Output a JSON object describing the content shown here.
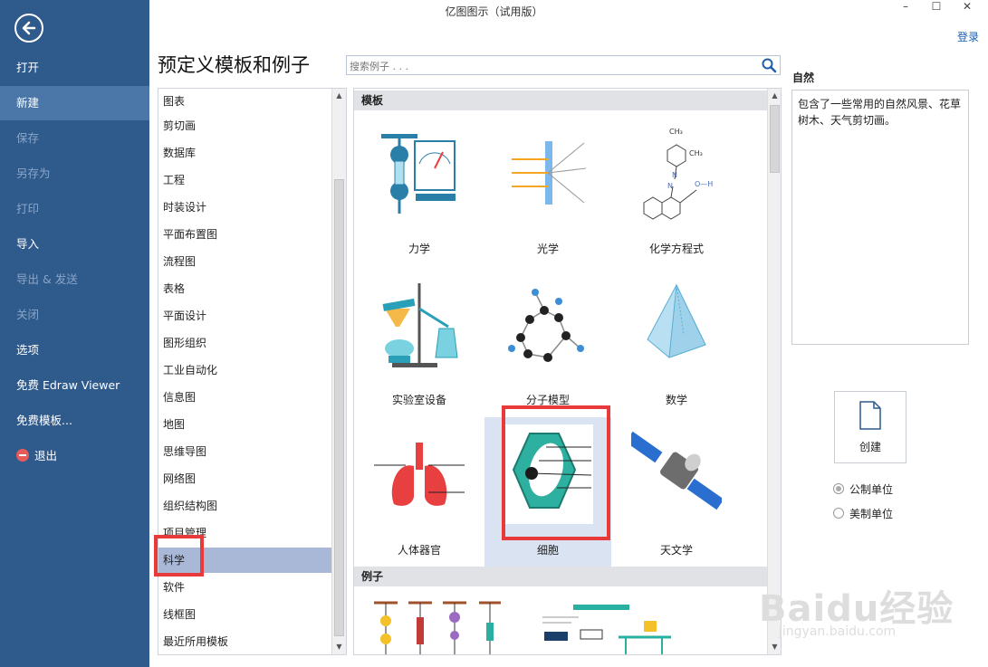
{
  "window": {
    "title": "亿图图示（试用版）",
    "min": "–",
    "max": "☐",
    "close": "✕",
    "login": "登录"
  },
  "sidebar": {
    "items": [
      {
        "label": "打开",
        "state": "normal"
      },
      {
        "label": "新建",
        "state": "active"
      },
      {
        "label": "保存",
        "state": "dim"
      },
      {
        "label": "另存为",
        "state": "dim"
      },
      {
        "label": "打印",
        "state": "dim"
      },
      {
        "label": "导入",
        "state": "normal"
      },
      {
        "label": "导出 & 发送",
        "state": "dim"
      },
      {
        "label": "关闭",
        "state": "dim"
      },
      {
        "label": "选项",
        "state": "normal"
      },
      {
        "label": "免费 Edraw Viewer",
        "state": "normal"
      },
      {
        "label": "免费模板...",
        "state": "normal"
      },
      {
        "label": "退出",
        "state": "normal"
      }
    ]
  },
  "main": {
    "heading": "预定义模板和例子",
    "search_placeholder": "搜索例子 . . ."
  },
  "categories": [
    "图表",
    "剪切画",
    "数据库",
    "工程",
    "时装设计",
    "平面布置图",
    "流程图",
    "表格",
    "平面设计",
    "图形组织",
    "工业自动化",
    "信息图",
    "地图",
    "思维导图",
    "网络图",
    "组织结构图",
    "项目管理",
    "科学",
    "软件",
    "线框图",
    "最近所用模板"
  ],
  "selected_category": "科学",
  "gallery": {
    "templates_header": "模板",
    "examples_header": "例子",
    "templates": [
      {
        "label": "力学",
        "icon": "mechanics-icon"
      },
      {
        "label": "光学",
        "icon": "optics-icon"
      },
      {
        "label": "化学方程式",
        "icon": "chemical-equation-icon"
      },
      {
        "label": "实验室设备",
        "icon": "lab-equipment-icon"
      },
      {
        "label": "分子模型",
        "icon": "molecule-model-icon"
      },
      {
        "label": "数学",
        "icon": "pyramid-icon"
      },
      {
        "label": "人体器官",
        "icon": "lungs-icon"
      },
      {
        "label": "细胞",
        "icon": "cell-icon"
      },
      {
        "label": "天文学",
        "icon": "satellite-icon"
      }
    ],
    "selected_template": "细胞"
  },
  "right_panel": {
    "title": "自然",
    "description": "包含了一些常用的自然风景、花草树木、天气剪切画。",
    "create_label": "创建",
    "units": [
      {
        "label": "公制单位",
        "selected": true
      },
      {
        "label": "美制单位",
        "selected": false
      }
    ]
  },
  "chem": {
    "ch3a": "CH₃",
    "ch3b": "CH₃",
    "n1": "N",
    "n2": "N",
    "oh": "O—H"
  },
  "watermark": {
    "main": "Baidu经验",
    "sub": "jingyan.baidu.com"
  },
  "colors": {
    "sidebar": "#2f5a8c",
    "sidebar_active": "#4a76a8",
    "selection": "#a9b8d7",
    "highlight_box": "#e83a3a",
    "link": "#1a5fb4"
  }
}
